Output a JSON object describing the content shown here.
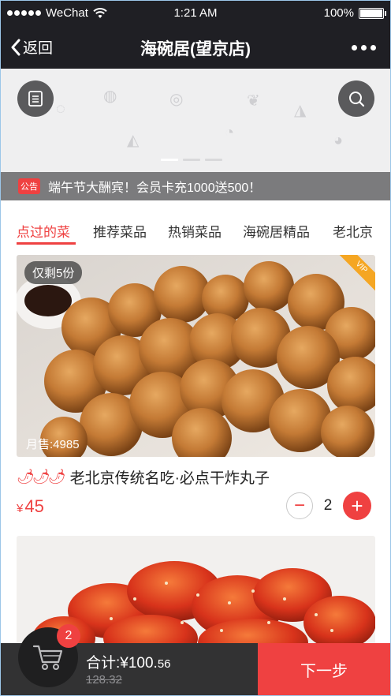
{
  "status_bar": {
    "carrier": "WeChat",
    "time": "1:21 AM",
    "battery": "100%"
  },
  "nav": {
    "back_label": "返回",
    "title": "海碗居(望京店)"
  },
  "notice": {
    "tag": "公告",
    "text": "端午节大酬宾！会员卡充1000送500！"
  },
  "tabs": [
    {
      "label": "点过的菜",
      "active": true
    },
    {
      "label": "推荐菜品"
    },
    {
      "label": "热销菜品"
    },
    {
      "label": "海碗居精品"
    },
    {
      "label": "老北京"
    }
  ],
  "dish": {
    "stock_badge": "仅剩5份",
    "vip": "VIP",
    "sales": "月售:4985",
    "name": "老北京传统名吃·必点干炸丸子",
    "currency": "¥",
    "price": "45",
    "quantity": "2"
  },
  "cart": {
    "count": "2",
    "total_label": "合计:¥100.",
    "total_cents": "56",
    "original": "128.32",
    "next_label": "下一步"
  },
  "colors": {
    "accent": "#ef4141",
    "dark": "#1f1f24"
  }
}
